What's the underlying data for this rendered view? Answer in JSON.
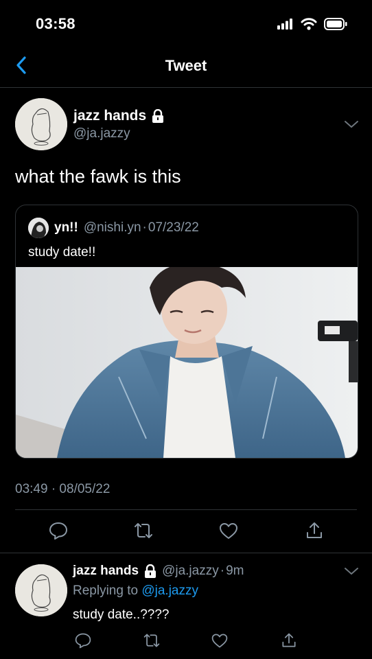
{
  "status_bar": {
    "time": "03:58"
  },
  "header": {
    "title": "Tweet"
  },
  "main_tweet": {
    "author_name": "jazz hands",
    "author_handle": "@ja.jazzy",
    "text": "what the fawk is this",
    "quoted": {
      "author_name": "yn!!",
      "author_handle": "@nishi.yn",
      "date_sep": "·",
      "date": "07/23/22",
      "text": "study date!!"
    },
    "timestamp": "03:49 · 08/05/22"
  },
  "reply": {
    "author_name": "jazz hands",
    "author_handle": "@ja.jazzy",
    "time_sep": "·",
    "time_ago": "9m",
    "replying_to_label": "Replying to",
    "replying_to_handle": "@ja.jazzy",
    "text": "study date..????"
  },
  "colors": {
    "accent": "#1d9bf0",
    "background": "#000000",
    "secondary_text": "#8b98a5",
    "divider": "#2f3336"
  },
  "icons": [
    "chevron-left-icon",
    "lock-icon",
    "chevron-down-icon",
    "reply-icon",
    "retweet-icon",
    "like-icon",
    "share-icon",
    "signal-icon",
    "wifi-icon",
    "battery-icon"
  ]
}
